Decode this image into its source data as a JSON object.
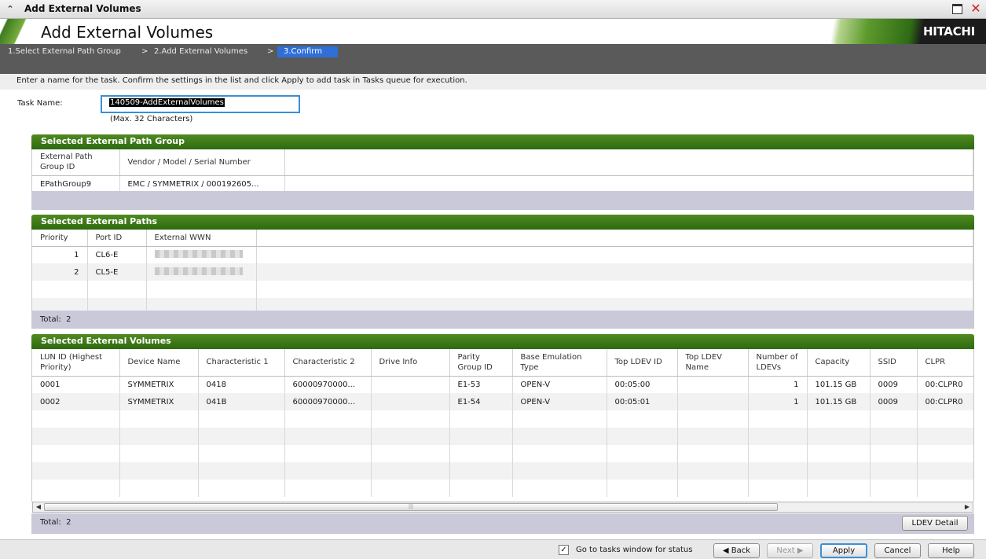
{
  "window": {
    "title": "Add External Volumes"
  },
  "banner": {
    "title": "Add External Volumes",
    "brand": "HITACHI"
  },
  "steps": [
    {
      "label": "1.Select External Path Group"
    },
    {
      "label": "2.Add External Volumes"
    },
    {
      "label": "3.Confirm"
    }
  ],
  "steps_separator": ">",
  "instruction": "Enter a name for the task. Confirm the settings in the list and click Apply to add task in Tasks queue for execution.",
  "task": {
    "label": "Task Name:",
    "value": "140509-AddExternalVolumes",
    "hint": "(Max. 32 Characters)"
  },
  "path_group": {
    "title": "Selected External Path Group",
    "headers": [
      "External Path Group ID",
      "Vendor / Model / Serial Number"
    ],
    "rows": [
      [
        "EPathGroup9",
        "EMC / SYMMETRIX / 000192605..."
      ]
    ]
  },
  "paths": {
    "title": "Selected External Paths",
    "headers": [
      "Priority",
      "Port ID",
      "External WWN"
    ],
    "rows": [
      [
        "1",
        "CL6-E"
      ],
      [
        "2",
        "CL5-E"
      ]
    ],
    "total_label": "Total:",
    "total": "2"
  },
  "volumes": {
    "title": "Selected External Volumes",
    "headers": [
      "LUN ID (Highest Priority)",
      "Device Name",
      "Characteristic 1",
      "Characteristic 2",
      "Drive Info",
      "Parity Group ID",
      "Base Emulation Type",
      "Top LDEV ID",
      "Top LDEV Name",
      "Number of LDEVs",
      "Capacity",
      "SSID",
      "CLPR"
    ],
    "rows": [
      [
        "0001",
        "SYMMETRIX",
        "0418",
        "60000970000...",
        "",
        "E1-53",
        "OPEN-V",
        "00:05:00",
        "",
        "1",
        "101.15 GB",
        "0009",
        "00:CLPR0"
      ],
      [
        "0002",
        "SYMMETRIX",
        "041B",
        "60000970000...",
        "",
        "E1-54",
        "OPEN-V",
        "00:05:01",
        "",
        "1",
        "101.15 GB",
        "0009",
        "00:CLPR0"
      ]
    ],
    "total_label": "Total:",
    "total": "2",
    "ldev_detail_label": "LDEV Detail"
  },
  "footer": {
    "go_to_tasks_label": "Go to tasks window for status",
    "go_to_tasks_checked": true,
    "back_label": "Back",
    "next_label": "Next",
    "apply_label": "Apply",
    "cancel_label": "Cancel",
    "help_label": "Help"
  }
}
